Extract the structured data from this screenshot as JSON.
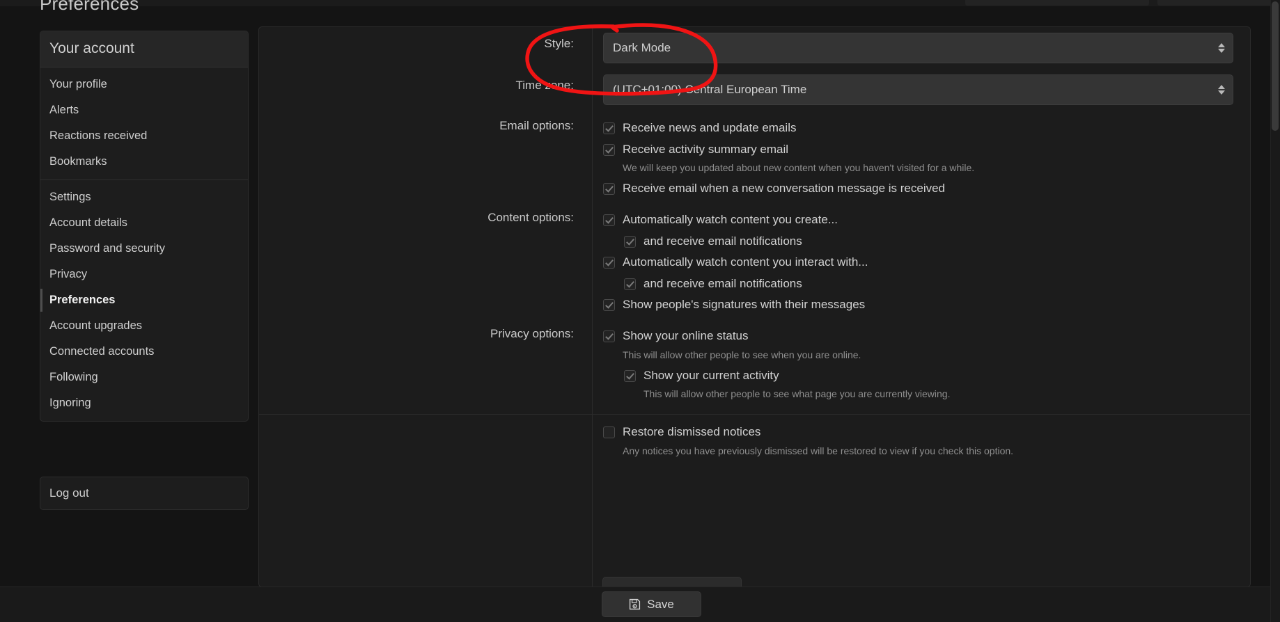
{
  "page": {
    "title": "Preferences"
  },
  "sidebar": {
    "header": "Your account",
    "groups": [
      {
        "items": [
          {
            "label": "Your profile",
            "active": false
          },
          {
            "label": "Alerts",
            "active": false
          },
          {
            "label": "Reactions received",
            "active": false
          },
          {
            "label": "Bookmarks",
            "active": false
          }
        ]
      },
      {
        "items": [
          {
            "label": "Settings",
            "active": false
          },
          {
            "label": "Account details",
            "active": false
          },
          {
            "label": "Password and security",
            "active": false
          },
          {
            "label": "Privacy",
            "active": false
          },
          {
            "label": "Preferences",
            "active": true
          },
          {
            "label": "Account upgrades",
            "active": false
          },
          {
            "label": "Connected accounts",
            "active": false
          },
          {
            "label": "Following",
            "active": false
          },
          {
            "label": "Ignoring",
            "active": false
          }
        ]
      }
    ],
    "logout": "Log out"
  },
  "form": {
    "style": {
      "label": "Style:",
      "value": "Dark Mode"
    },
    "timezone": {
      "label": "Time zone:",
      "value": "(UTC+01:00) Central European Time"
    },
    "email_options": {
      "label": "Email options:",
      "items": [
        {
          "label": "Receive news and update emails",
          "checked": true,
          "hint": ""
        },
        {
          "label": "Receive activity summary email",
          "checked": true,
          "hint": "We will keep you updated about new content when you haven't visited for a while."
        },
        {
          "label": "Receive email when a new conversation message is received",
          "checked": true,
          "hint": ""
        }
      ]
    },
    "content_options": {
      "label": "Content options:",
      "items": [
        {
          "label": "Automatically watch content you create...",
          "checked": true,
          "indent": false,
          "hint": ""
        },
        {
          "label": "and receive email notifications",
          "checked": true,
          "indent": true,
          "hint": ""
        },
        {
          "label": "Automatically watch content you interact with...",
          "checked": true,
          "indent": false,
          "hint": ""
        },
        {
          "label": "and receive email notifications",
          "checked": true,
          "indent": true,
          "hint": ""
        },
        {
          "label": "Show people's signatures with their messages",
          "checked": true,
          "indent": false,
          "hint": ""
        }
      ]
    },
    "privacy_options": {
      "label": "Privacy options:",
      "items": [
        {
          "label": "Show your online status",
          "checked": true,
          "indent": false,
          "hint": "This will allow other people to see when you are online."
        },
        {
          "label": "Show your current activity",
          "checked": true,
          "indent": true,
          "hint": "This will allow other people to see what page you are currently viewing."
        }
      ]
    },
    "misc_options": {
      "label": "",
      "items": [
        {
          "label": "Restore dismissed notices",
          "checked": false,
          "indent": false,
          "hint": "Any notices you have previously dismissed will be restored to view if you check this option."
        }
      ]
    }
  },
  "footer": {
    "save_label": "Save"
  },
  "annotation": {
    "shape": "red-ellipse",
    "color": "#f01414",
    "targets": "Style: Dark Mode"
  },
  "colors": {
    "page_bg": "#141414",
    "panel_bg": "#1c1c1c",
    "sidebar_bg": "#1d1d1d",
    "select_bg": "#343434",
    "text": "#cfcfcf",
    "muted_text": "#8f8f8f",
    "accent_red": "#f01414"
  }
}
